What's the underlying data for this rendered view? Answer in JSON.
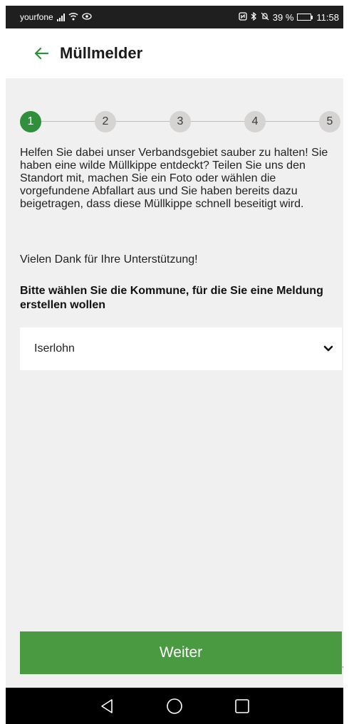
{
  "status_bar": {
    "carrier": "yourfone",
    "battery_text": "39 %",
    "battery_level": 0.39,
    "time": "11:58"
  },
  "app_bar": {
    "title": "Müllmelder",
    "back_icon": "arrow-left-icon"
  },
  "stepper": {
    "steps": [
      "1",
      "2",
      "3",
      "4",
      "5"
    ],
    "active_step": 1
  },
  "content": {
    "intro": "Helfen Sie dabei unser Verbandsgebiet sauber zu halten! Sie haben eine wilde Müllkippe entdeckt? Teilen Sie uns den Standort mit, machen Sie ein Foto oder wählen die vorgefundene Abfallart aus und Sie haben bereits dazu beigetragen, dass diese Müllkippe schnell beseitigt wird.",
    "thanks": "Vielen Dank für Ihre Unterstützung!",
    "question": "Bitte wählen Sie die Kommune, für die Sie eine Meldung erstellen wollen"
  },
  "municipality_select": {
    "selected": "Iserlohn"
  },
  "actions": {
    "next_label": "Weiter"
  },
  "colors": {
    "accent_green": "#2f8f3a",
    "button_green": "#4a9a41",
    "background": "#f0f0f0"
  }
}
